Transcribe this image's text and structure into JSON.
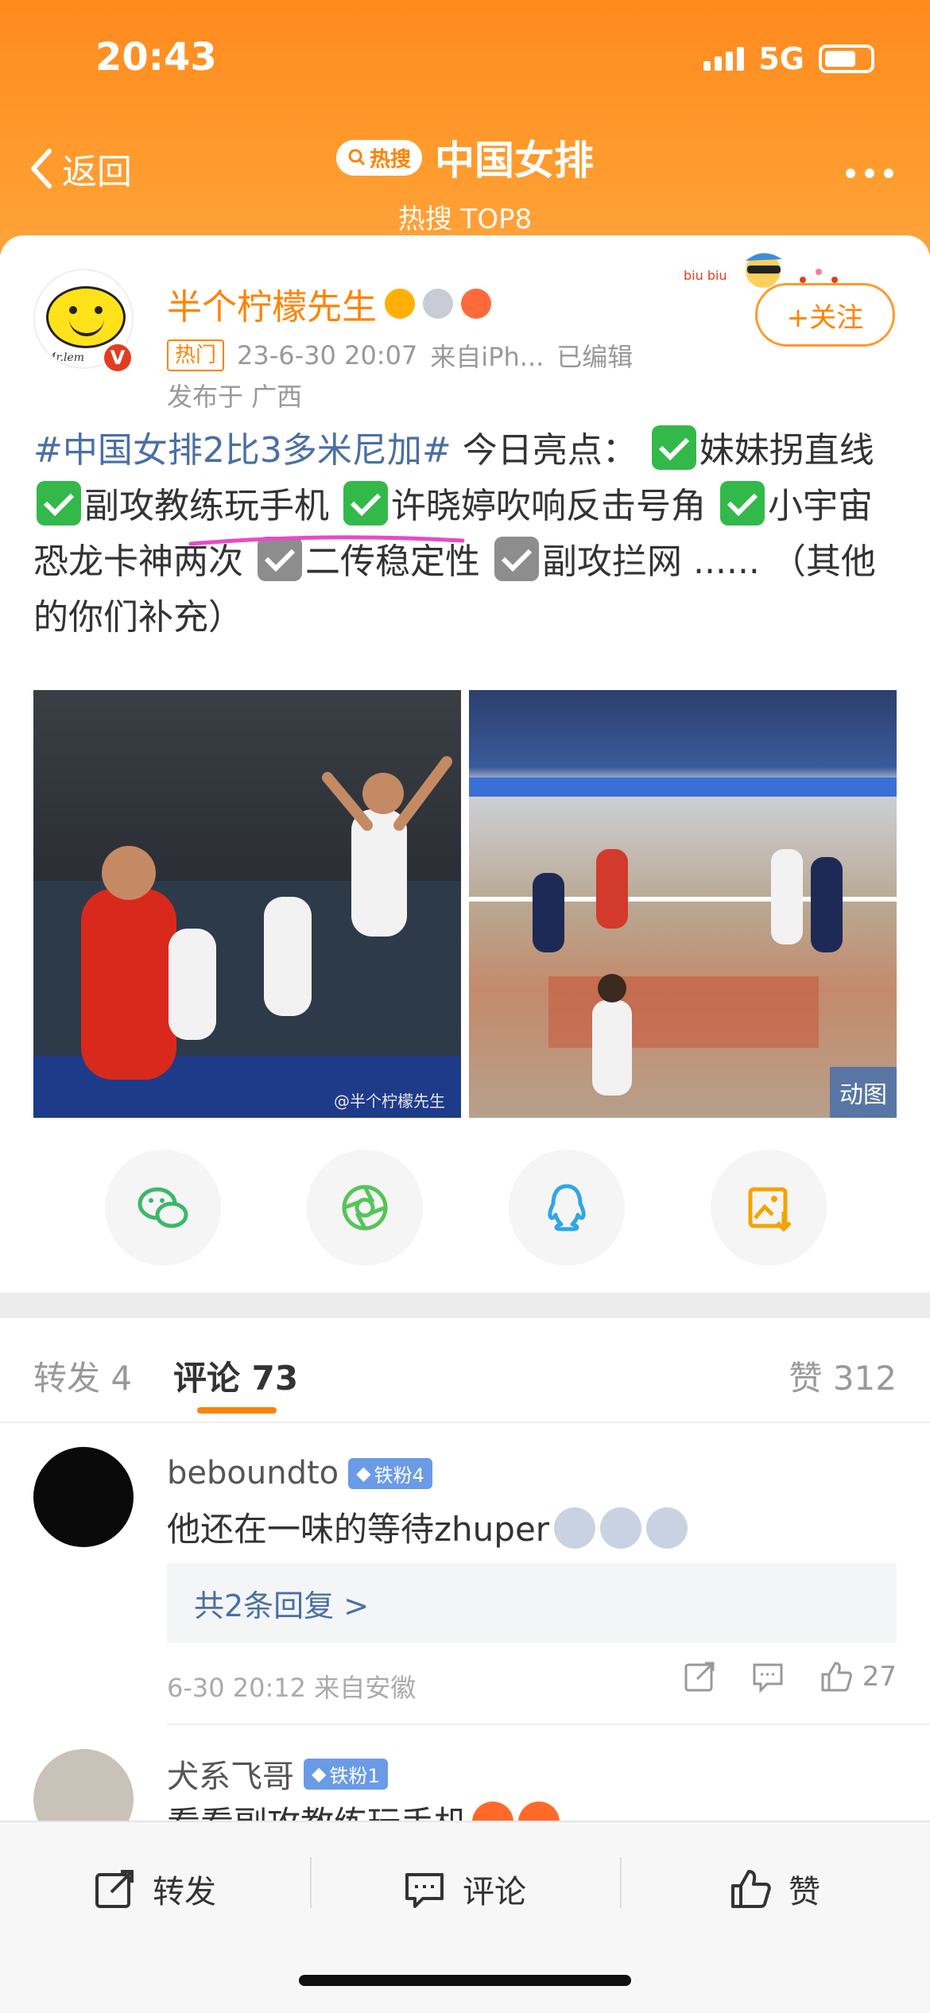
{
  "status_bar": {
    "time": "20:43",
    "network": "5G"
  },
  "nav": {
    "back_label": "返回",
    "hot_tag": "热搜",
    "title": "中国女排",
    "subtitle": "热搜 TOP8"
  },
  "post": {
    "username": "半个柠檬先生",
    "avatar_caption": "Mr.lem",
    "verified": "V",
    "hot_badge": "热门",
    "timestamp": "23-6-30 20:07",
    "source": "来自iPh...",
    "edited": "已编辑",
    "location": "发布于 广西",
    "follow_label": "+关注",
    "follow_deco": "biu biu",
    "hashtag": "#中国女排2比3多米尼加#",
    "text_intro": " 今日亮点：",
    "items": [
      {
        "check": "green",
        "text": "妹妹拐直线"
      },
      {
        "check": "green",
        "text": "副攻教练玩手机"
      },
      {
        "check": "green",
        "text": "许晓婷吹响反击号角"
      },
      {
        "check": "green",
        "text": "小宇宙恐龙卡神两次"
      },
      {
        "check": "gray",
        "text": "二传稳定性"
      },
      {
        "check": "gray",
        "text": "副攻拦网"
      }
    ],
    "text_outro": "...... （其他的你们补充）",
    "images": {
      "watermark": "@半个柠檬先生",
      "gif_badge": "动图"
    },
    "share_icons": [
      "wechat-icon",
      "moments-icon",
      "qq-icon",
      "save-image-icon"
    ]
  },
  "tabs": {
    "repost": "转发 4",
    "comments": "评论 73",
    "likes": "赞 312"
  },
  "comments": [
    {
      "name": "beboundto",
      "fan_badge": "铁粉4",
      "text": "他还在一味的等待zhuper",
      "replies": "共2条回复 >",
      "meta": "6-30 20:12 来自安徽",
      "likes": "27"
    },
    {
      "name": "犬系飞哥",
      "fan_badge": "铁粉1",
      "text": "看看副攻教练玩手机"
    }
  ],
  "bottom_bar": {
    "repost": "转发",
    "comment": "评论",
    "like": "赞"
  },
  "colors": {
    "brand_orange": "#ff8200",
    "header_gradient_top": "#ff8a1e",
    "hashtag_blue": "#4a6fa5",
    "check_green": "#33b94a"
  }
}
